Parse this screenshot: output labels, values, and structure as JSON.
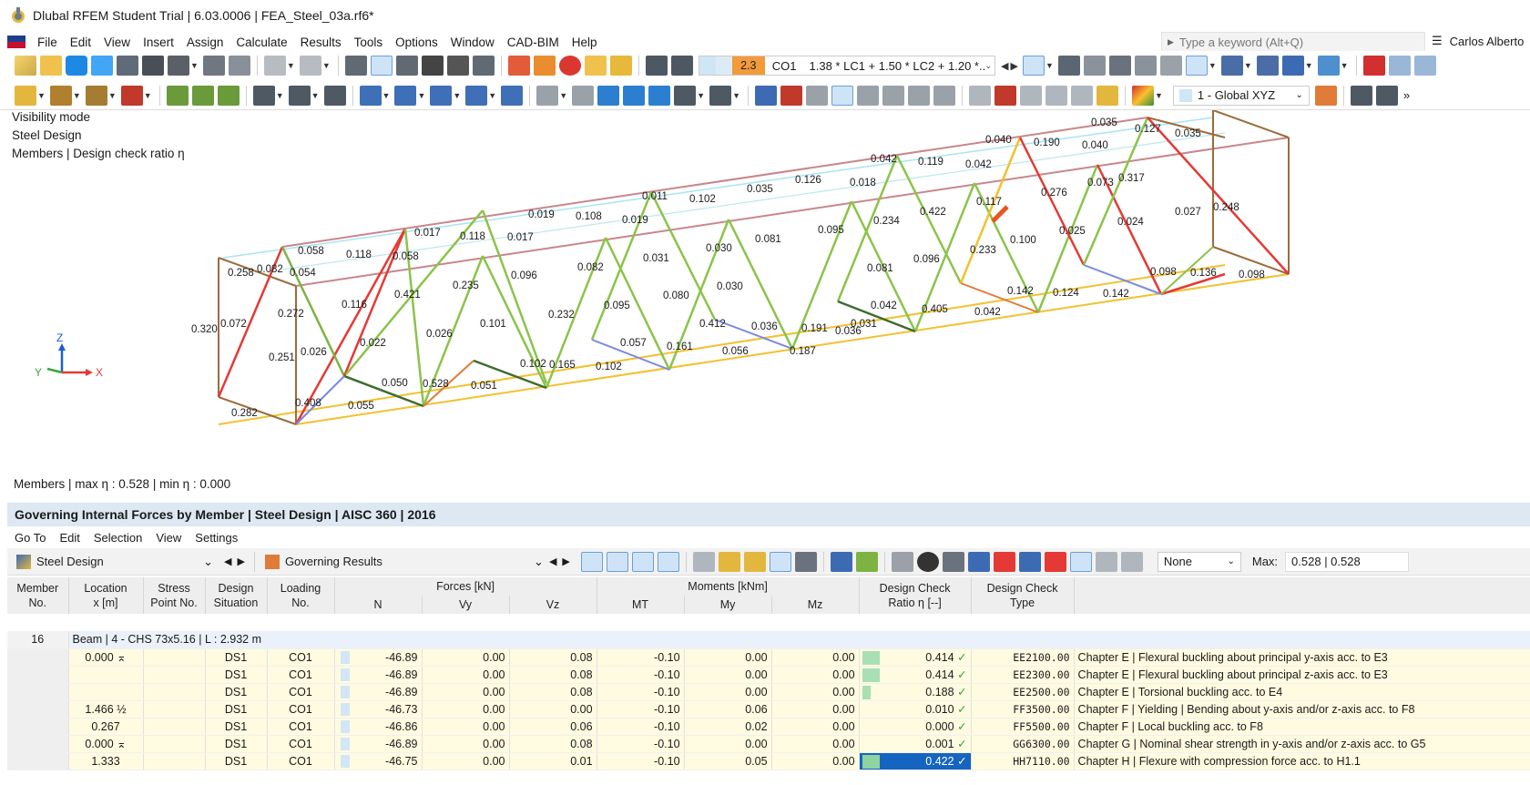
{
  "window": {
    "title": "Dlubal RFEM Student Trial | 6.03.0006 | FEA_Steel_03a.rf6*"
  },
  "menu": {
    "items": [
      "File",
      "Edit",
      "View",
      "Insert",
      "Assign",
      "Calculate",
      "Results",
      "Tools",
      "Options",
      "Window",
      "CAD-BIM",
      "Help"
    ],
    "search_placeholder": "Type a keyword (Alt+Q)",
    "user": "Carlos Alberto"
  },
  "toolbar": {
    "load_case_num": "2.3",
    "load_case": "CO1",
    "load_combo_formula": "1.38 * LC1 + 1.50 * LC2 + 1.20 *...",
    "coord_system": "1 - Global XYZ"
  },
  "viewport": {
    "info_lines": [
      "Visibility mode",
      "Steel Design",
      "Members | Design check ratio η"
    ],
    "axes": {
      "x": "X",
      "y": "Y",
      "z": "Z"
    },
    "member_labels": [
      "0.320",
      "0.072",
      "0.258",
      "0.082",
      "0.054",
      "0.058",
      "0.118",
      "0.017",
      "0.118",
      "0.017",
      "0.058",
      "0.019",
      "0.108",
      "0.019",
      "0.011",
      "0.102",
      "0.035",
      "0.126",
      "0.018",
      "0.042",
      "0.119",
      "0.042",
      "0.040",
      "0.190",
      "0.040",
      "0.035",
      "0.127",
      "0.035",
      "0.272",
      "0.116",
      "0.421",
      "0.235",
      "0.096",
      "0.082",
      "0.031",
      "0.030",
      "0.081",
      "0.095",
      "0.234",
      "0.422",
      "0.117",
      "0.276",
      "0.073",
      "0.317",
      "0.027",
      "0.248",
      "0.024",
      "0.100",
      "0.025",
      "0.233",
      "0.096",
      "0.081",
      "0.031",
      "0.030",
      "0.080",
      "0.095",
      "0.232",
      "0.101",
      "0.026",
      "0.022",
      "0.251",
      "0.026",
      "0.282",
      "0.408",
      "0.055",
      "0.050",
      "0.528",
      "0.051",
      "0.102",
      "0.165",
      "0.102",
      "0.057",
      "0.161",
      "0.056",
      "0.412",
      "0.036",
      "0.191",
      "0.036",
      "0.187",
      "0.042",
      "0.405",
      "0.042",
      "0.142",
      "0.124",
      "0.142",
      "0.098",
      "0.136",
      "0.098"
    ],
    "status": "Members | max η : 0.528 | min η : 0.000"
  },
  "panel": {
    "title": "Governing Internal Forces by Member | Steel Design | AISC 360 | 2016",
    "menu": [
      "Go To",
      "Edit",
      "Selection",
      "View",
      "Settings"
    ],
    "module": "Steel Design",
    "result_type": "Governing Results",
    "filter": "None",
    "max_label": "Max:",
    "max_value": "0.528 | 0.528"
  },
  "table": {
    "headers": {
      "member": [
        "Member",
        "No."
      ],
      "location": [
        "Location",
        "x [m]"
      ],
      "stress": [
        "Stress",
        "Point No."
      ],
      "design": [
        "Design",
        "Situation"
      ],
      "loading": [
        "Loading",
        "No."
      ],
      "forces": "Forces [kN]",
      "moments": "Moments [kNm]",
      "n": "N",
      "vy": "Vy",
      "vz": "Vz",
      "mt": "MT",
      "my": "My",
      "mz": "Mz",
      "ratio": [
        "Design Check",
        "Ratio η [--]"
      ],
      "type": [
        "Design Check",
        "Type"
      ]
    },
    "group": {
      "member": "16",
      "desc": "Beam | 4 - CHS 73x5.16 | L : 2.932 m"
    },
    "rows": [
      {
        "loc": "0.000 ⌅",
        "sit": "DS1",
        "load": "CO1",
        "n": "-46.89",
        "vy": "0.00",
        "vz": "0.08",
        "mt": "-0.10",
        "my": "0.00",
        "mz": "0.00",
        "ratio": "0.414",
        "ratio_frac": 0.78,
        "code": "EE2100.00",
        "desc": "Chapter E | Flexural buckling about principal y-axis acc. to E3"
      },
      {
        "loc": "",
        "sit": "DS1",
        "load": "CO1",
        "n": "-46.89",
        "vy": "0.00",
        "vz": "0.08",
        "mt": "-0.10",
        "my": "0.00",
        "mz": "0.00",
        "ratio": "0.414",
        "ratio_frac": 0.78,
        "code": "EE2300.00",
        "desc": "Chapter E | Flexural buckling about principal z-axis acc. to E3"
      },
      {
        "loc": "",
        "sit": "DS1",
        "load": "CO1",
        "n": "-46.89",
        "vy": "0.00",
        "vz": "0.08",
        "mt": "-0.10",
        "my": "0.00",
        "mz": "0.00",
        "ratio": "0.188",
        "ratio_frac": 0.36,
        "code": "EE2500.00",
        "desc": "Chapter E | Torsional buckling acc. to E4"
      },
      {
        "loc": "1.466 ½",
        "sit": "DS1",
        "load": "CO1",
        "n": "-46.73",
        "vy": "0.00",
        "vz": "0.00",
        "mt": "-0.10",
        "my": "0.06",
        "mz": "0.00",
        "ratio": "0.010",
        "ratio_frac": 0.02,
        "code": "FF3500.00",
        "desc": "Chapter F | Yielding | Bending about y-axis and/or z-axis acc. to F8"
      },
      {
        "loc": "0.267",
        "sit": "DS1",
        "load": "CO1",
        "n": "-46.86",
        "vy": "0.00",
        "vz": "0.06",
        "mt": "-0.10",
        "my": "0.02",
        "mz": "0.00",
        "ratio": "0.000",
        "ratio_frac": 0.0,
        "code": "FF5500.00",
        "desc": "Chapter F | Local buckling acc. to F8"
      },
      {
        "loc": "0.000 ⌅",
        "sit": "DS1",
        "load": "CO1",
        "n": "-46.89",
        "vy": "0.00",
        "vz": "0.08",
        "mt": "-0.10",
        "my": "0.00",
        "mz": "0.00",
        "ratio": "0.001",
        "ratio_frac": 0.0,
        "code": "GG6300.00",
        "desc": "Chapter G | Nominal shear strength in y-axis and/or z-axis acc. to G5"
      },
      {
        "loc": "1.333",
        "sit": "DS1",
        "load": "CO1",
        "n": "-46.75",
        "vy": "0.00",
        "vz": "0.01",
        "mt": "-0.10",
        "my": "0.05",
        "mz": "0.00",
        "ratio": "0.422",
        "ratio_frac": 0.8,
        "code": "HH7110.00",
        "desc": "Chapter H | Flexure with compression force acc. to H1.1",
        "selected": true
      }
    ]
  }
}
